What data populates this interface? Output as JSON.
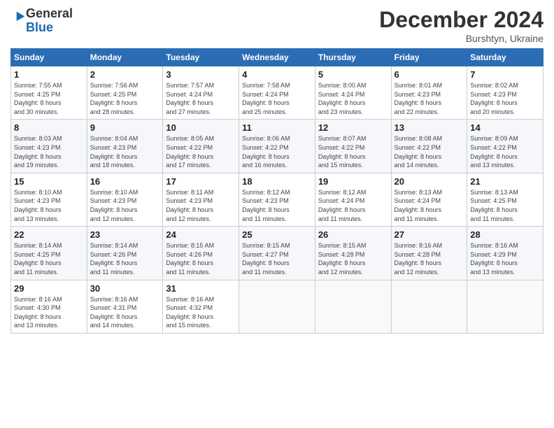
{
  "header": {
    "logo_general": "General",
    "logo_blue": "Blue",
    "month_title": "December 2024",
    "location": "Burshtyn, Ukraine"
  },
  "weekdays": [
    "Sunday",
    "Monday",
    "Tuesday",
    "Wednesday",
    "Thursday",
    "Friday",
    "Saturday"
  ],
  "weeks": [
    [
      {
        "day": "1",
        "info": "Sunrise: 7:55 AM\nSunset: 4:25 PM\nDaylight: 8 hours\nand 30 minutes."
      },
      {
        "day": "2",
        "info": "Sunrise: 7:56 AM\nSunset: 4:25 PM\nDaylight: 8 hours\nand 28 minutes."
      },
      {
        "day": "3",
        "info": "Sunrise: 7:57 AM\nSunset: 4:24 PM\nDaylight: 8 hours\nand 27 minutes."
      },
      {
        "day": "4",
        "info": "Sunrise: 7:58 AM\nSunset: 4:24 PM\nDaylight: 8 hours\nand 25 minutes."
      },
      {
        "day": "5",
        "info": "Sunrise: 8:00 AM\nSunset: 4:24 PM\nDaylight: 8 hours\nand 23 minutes."
      },
      {
        "day": "6",
        "info": "Sunrise: 8:01 AM\nSunset: 4:23 PM\nDaylight: 8 hours\nand 22 minutes."
      },
      {
        "day": "7",
        "info": "Sunrise: 8:02 AM\nSunset: 4:23 PM\nDaylight: 8 hours\nand 20 minutes."
      }
    ],
    [
      {
        "day": "8",
        "info": "Sunrise: 8:03 AM\nSunset: 4:23 PM\nDaylight: 8 hours\nand 19 minutes."
      },
      {
        "day": "9",
        "info": "Sunrise: 8:04 AM\nSunset: 4:23 PM\nDaylight: 8 hours\nand 18 minutes."
      },
      {
        "day": "10",
        "info": "Sunrise: 8:05 AM\nSunset: 4:22 PM\nDaylight: 8 hours\nand 17 minutes."
      },
      {
        "day": "11",
        "info": "Sunrise: 8:06 AM\nSunset: 4:22 PM\nDaylight: 8 hours\nand 16 minutes."
      },
      {
        "day": "12",
        "info": "Sunrise: 8:07 AM\nSunset: 4:22 PM\nDaylight: 8 hours\nand 15 minutes."
      },
      {
        "day": "13",
        "info": "Sunrise: 8:08 AM\nSunset: 4:22 PM\nDaylight: 8 hours\nand 14 minutes."
      },
      {
        "day": "14",
        "info": "Sunrise: 8:09 AM\nSunset: 4:22 PM\nDaylight: 8 hours\nand 13 minutes."
      }
    ],
    [
      {
        "day": "15",
        "info": "Sunrise: 8:10 AM\nSunset: 4:23 PM\nDaylight: 8 hours\nand 13 minutes."
      },
      {
        "day": "16",
        "info": "Sunrise: 8:10 AM\nSunset: 4:23 PM\nDaylight: 8 hours\nand 12 minutes."
      },
      {
        "day": "17",
        "info": "Sunrise: 8:11 AM\nSunset: 4:23 PM\nDaylight: 8 hours\nand 12 minutes."
      },
      {
        "day": "18",
        "info": "Sunrise: 8:12 AM\nSunset: 4:23 PM\nDaylight: 8 hours\nand 11 minutes."
      },
      {
        "day": "19",
        "info": "Sunrise: 8:12 AM\nSunset: 4:24 PM\nDaylight: 8 hours\nand 11 minutes."
      },
      {
        "day": "20",
        "info": "Sunrise: 8:13 AM\nSunset: 4:24 PM\nDaylight: 8 hours\nand 11 minutes."
      },
      {
        "day": "21",
        "info": "Sunrise: 8:13 AM\nSunset: 4:25 PM\nDaylight: 8 hours\nand 11 minutes."
      }
    ],
    [
      {
        "day": "22",
        "info": "Sunrise: 8:14 AM\nSunset: 4:25 PM\nDaylight: 8 hours\nand 11 minutes."
      },
      {
        "day": "23",
        "info": "Sunrise: 8:14 AM\nSunset: 4:26 PM\nDaylight: 8 hours\nand 11 minutes."
      },
      {
        "day": "24",
        "info": "Sunrise: 8:15 AM\nSunset: 4:26 PM\nDaylight: 8 hours\nand 11 minutes."
      },
      {
        "day": "25",
        "info": "Sunrise: 8:15 AM\nSunset: 4:27 PM\nDaylight: 8 hours\nand 11 minutes."
      },
      {
        "day": "26",
        "info": "Sunrise: 8:15 AM\nSunset: 4:28 PM\nDaylight: 8 hours\nand 12 minutes."
      },
      {
        "day": "27",
        "info": "Sunrise: 8:16 AM\nSunset: 4:28 PM\nDaylight: 8 hours\nand 12 minutes."
      },
      {
        "day": "28",
        "info": "Sunrise: 8:16 AM\nSunset: 4:29 PM\nDaylight: 8 hours\nand 13 minutes."
      }
    ],
    [
      {
        "day": "29",
        "info": "Sunrise: 8:16 AM\nSunset: 4:30 PM\nDaylight: 8 hours\nand 13 minutes."
      },
      {
        "day": "30",
        "info": "Sunrise: 8:16 AM\nSunset: 4:31 PM\nDaylight: 8 hours\nand 14 minutes."
      },
      {
        "day": "31",
        "info": "Sunrise: 8:16 AM\nSunset: 4:32 PM\nDaylight: 8 hours\nand 15 minutes."
      },
      {
        "day": "",
        "info": ""
      },
      {
        "day": "",
        "info": ""
      },
      {
        "day": "",
        "info": ""
      },
      {
        "day": "",
        "info": ""
      }
    ]
  ]
}
